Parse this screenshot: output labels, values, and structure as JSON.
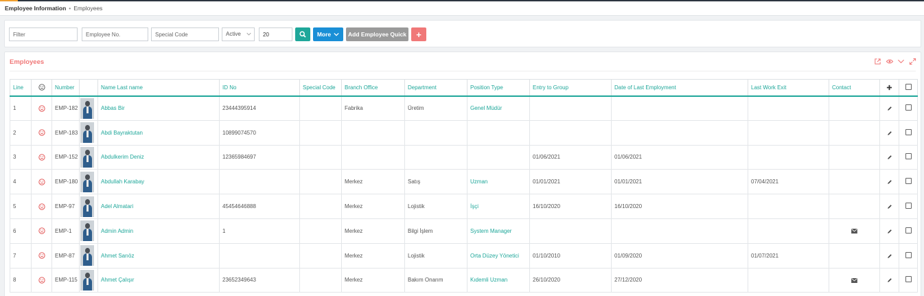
{
  "breadcrumb": {
    "main": "Employee Information",
    "separator": "•",
    "current": "Employees"
  },
  "filters": {
    "filter_placeholder": "Filter",
    "employee_no_placeholder": "Employee No.",
    "special_code_placeholder": "Special Code",
    "status_value": "Active",
    "page_size_value": "20",
    "more_label": "More",
    "add_quick_label": "Add Employee Quick",
    "add_label": "+"
  },
  "colors": {
    "accent": "#1fa79a",
    "more": "#1a8fd6",
    "grey_btn": "#9a9a9a",
    "add_btn": "#f07878",
    "title": "#f07878"
  },
  "panel": {
    "title": "Employees"
  },
  "table": {
    "headers": {
      "line": "Line",
      "number": "Number",
      "name": "Name Last name",
      "id_no": "ID No",
      "special_code": "Special Code",
      "branch": "Branch Office",
      "department": "Department",
      "position": "Position Type",
      "entry": "Entry to Group",
      "last_employment": "Date of Last Employment",
      "last_exit": "Last Work Exit",
      "contact": "Contact",
      "add": "+"
    },
    "rows": [
      {
        "line": "1",
        "number": "EMP-182",
        "name": "Abbas Bir",
        "id_no": "23444395914",
        "special_code": "",
        "branch": "Fabrika",
        "department": "Üretim",
        "position": "Genel Müdür",
        "entry": "",
        "last_employment": "",
        "last_exit": "",
        "contact": false
      },
      {
        "line": "2",
        "number": "EMP-183",
        "name": "Abdi Bayraktutan",
        "id_no": "10899074570",
        "special_code": "",
        "branch": "",
        "department": "",
        "position": "",
        "entry": "",
        "last_employment": "",
        "last_exit": "",
        "contact": false
      },
      {
        "line": "3",
        "number": "EMP-152",
        "name": "Abdulkerim Deniz",
        "id_no": "12365984697",
        "special_code": "",
        "branch": "",
        "department": "",
        "position": "",
        "entry": "01/06/2021",
        "last_employment": "01/06/2021",
        "last_exit": "",
        "contact": false
      },
      {
        "line": "4",
        "number": "EMP-180",
        "name": "Abdullah Karabay",
        "id_no": "",
        "special_code": "",
        "branch": "Merkez",
        "department": "Satış",
        "position": "Uzman",
        "entry": "01/01/2021",
        "last_employment": "01/01/2021",
        "last_exit": "07/04/2021",
        "contact": false
      },
      {
        "line": "5",
        "number": "EMP-97",
        "name": "Adel Almatari",
        "id_no": "45454646888",
        "special_code": "",
        "branch": "Merkez",
        "department": "Lojistik",
        "position": "İşçi",
        "entry": "16/10/2020",
        "last_employment": "16/10/2020",
        "last_exit": "",
        "contact": false
      },
      {
        "line": "6",
        "number": "EMP-1",
        "name": "Admin Admin",
        "id_no": "1",
        "special_code": "",
        "branch": "Merkez",
        "department": "Bilgi İşlem",
        "position": "System Manager",
        "entry": "",
        "last_employment": "",
        "last_exit": "",
        "contact": true
      },
      {
        "line": "7",
        "number": "EMP-87",
        "name": "Ahmet Sarıöz",
        "id_no": "",
        "special_code": "",
        "branch": "Merkez",
        "department": "Lojistik",
        "position": "Orta Düzey Yönetici",
        "entry": "01/10/2010",
        "last_employment": "01/09/2020",
        "last_exit": "01/07/2021",
        "contact": false
      },
      {
        "line": "8",
        "number": "EMP-115",
        "name": "Ahmet Çalışır",
        "id_no": "23652349643",
        "special_code": "",
        "branch": "Merkez",
        "department": "Bakım Onarım",
        "position": "Kıdemli Uzman",
        "entry": "26/10/2020",
        "last_employment": "27/12/2020",
        "last_exit": "",
        "contact": true
      }
    ]
  }
}
